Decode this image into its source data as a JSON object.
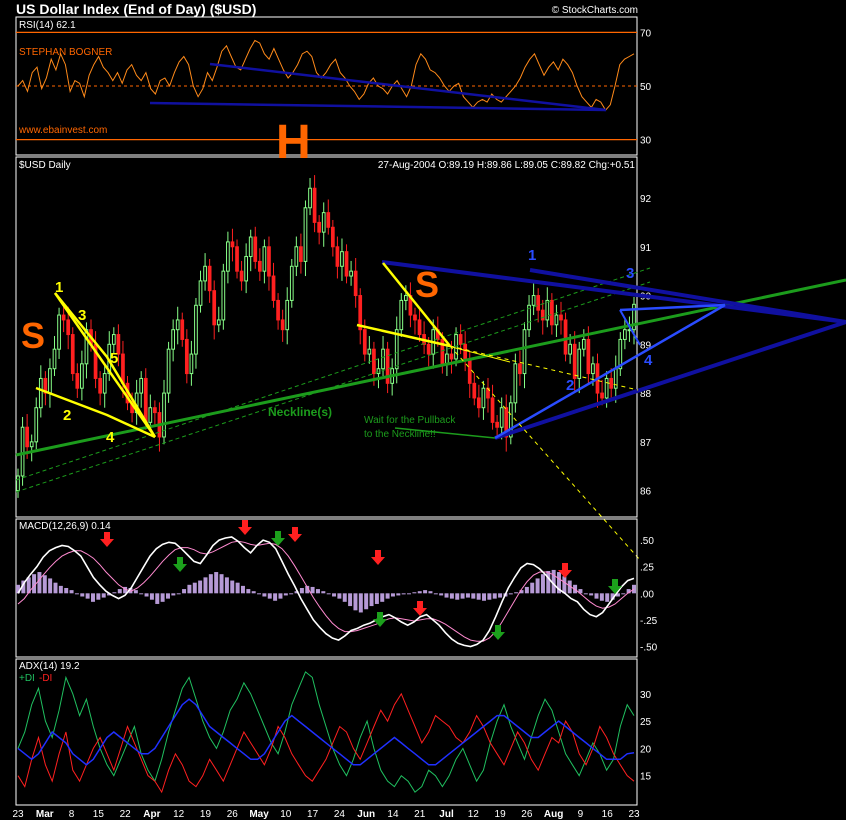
{
  "header": {
    "title": "US Dollar Index (End of Day) ($USD)",
    "copyright": "© StockCharts.com"
  },
  "colors": {
    "background": "#000000",
    "panel_border": "#ffffff",
    "orange_line": "#ff6600",
    "up_candle": "#88ff88",
    "down_candle": "#ff2020",
    "neckline_green": "#1c9c1c",
    "trend_blue": "#1010a0",
    "bright_blue": "#2a4cff",
    "yellow": "#ffff00",
    "hist": "#b69ad6",
    "macd_line": "#ffffff",
    "signal_line": "#ff8ad0",
    "plus_di": "#20c060",
    "minus_di": "#ff2020",
    "adx": "#2030ff"
  },
  "chart_data": [
    {
      "type": "line",
      "panel": "rsi",
      "label": "RSI(14) 62.1",
      "author": "STEPHAN BOGNER",
      "website": "www.ebainvest.com",
      "ylim": [
        25,
        75
      ],
      "ticks": [
        30,
        50,
        70
      ],
      "ref_lines": [
        30,
        50,
        70
      ],
      "series": [
        {
          "values": [
            50,
            52,
            48,
            55,
            57,
            49,
            53,
            60,
            56,
            62,
            58,
            48,
            52,
            51,
            46,
            54,
            58,
            61,
            57,
            55,
            52,
            55,
            51,
            56,
            58,
            54,
            52,
            55,
            49,
            47,
            52,
            53,
            50,
            55,
            59,
            61,
            58,
            50,
            46,
            49,
            55,
            52,
            57,
            63,
            65,
            61,
            57,
            56,
            60,
            64,
            67,
            66,
            62,
            60,
            64,
            60,
            56,
            53,
            55,
            58,
            62,
            63,
            61,
            55,
            53,
            55,
            58,
            60,
            55,
            53,
            50,
            48,
            45,
            47,
            51,
            53,
            50,
            49,
            47,
            50,
            52,
            49,
            46,
            50,
            58,
            62,
            60,
            56,
            55,
            53,
            50,
            48,
            50,
            51,
            46,
            44,
            42,
            44,
            45,
            44,
            47,
            45,
            44,
            46,
            48,
            50,
            53,
            57,
            60,
            62,
            58,
            54,
            57,
            59,
            56,
            60,
            58,
            55,
            50,
            46,
            44,
            42,
            45,
            44,
            41,
            43,
            50,
            58,
            60,
            61,
            62
          ]
        }
      ]
    },
    {
      "type": "candlestick",
      "panel": "price",
      "label": "$USD Daily",
      "quote": "27-Aug-2004 O:89.19 H:89.86 L:89.05 C:89.82 Chg:+0.51",
      "ylim": [
        85.5,
        92.8
      ],
      "ticks": [
        86,
        87,
        88,
        89,
        90,
        91,
        92
      ],
      "closes": [
        86.3,
        87.3,
        86.9,
        87.0,
        87.7,
        88.3,
        88.0,
        88.5,
        88.9,
        89.6,
        89.5,
        89.2,
        88.4,
        88.1,
        88.6,
        89.3,
        89.0,
        88.3,
        88.0,
        88.4,
        89.0,
        89.2,
        88.8,
        88.2,
        87.8,
        87.6,
        88.0,
        88.3,
        87.4,
        87.7,
        87.6,
        87.1,
        88.0,
        88.9,
        89.3,
        89.5,
        89.1,
        88.4,
        88.8,
        89.8,
        90.3,
        90.6,
        90.1,
        89.4,
        89.5,
        90.5,
        91.1,
        91.0,
        90.5,
        90.3,
        90.8,
        91.2,
        90.7,
        90.5,
        91.0,
        90.4,
        89.9,
        89.5,
        89.3,
        89.9,
        90.6,
        91.0,
        90.7,
        91.8,
        92.2,
        91.5,
        91.3,
        91.7,
        91.4,
        91.0,
        90.6,
        90.9,
        90.4,
        90.5,
        90.0,
        89.3,
        88.8,
        88.9,
        88.4,
        88.5,
        88.9,
        88.2,
        88.5,
        89.3,
        89.9,
        90.0,
        89.6,
        89.5,
        89.2,
        89.0,
        88.8,
        89.3,
        89.1,
        88.6,
        88.8,
        88.7,
        89.2,
        89.0,
        88.7,
        88.2,
        87.9,
        87.7,
        88.1,
        87.9,
        87.4,
        87.3,
        87.7,
        87.1,
        87.8,
        88.6,
        88.4,
        89.3,
        89.8,
        90.0,
        89.7,
        89.5,
        89.9,
        89.4,
        89.6,
        89.5,
        88.8,
        89.0,
        88.3,
        88.9,
        89.1,
        88.4,
        88.6,
        88.0,
        87.9,
        88.3,
        88.1,
        88.5,
        89.1,
        89.3,
        89.3,
        89.82
      ],
      "annotations": {
        "H": "H",
        "S_left": "S",
        "S_right": "S",
        "neckline": "Neckline(s)",
        "pullback": "Wait for the Pullback to the Neckline!!",
        "yellow_numbers": [
          "1",
          "2",
          "3",
          "4",
          "5"
        ],
        "blue_numbers": [
          "1",
          "2",
          "3",
          "4"
        ]
      }
    },
    {
      "type": "bar",
      "panel": "macd",
      "label": "MACD(12,26,9) 0.14",
      "ylim": [
        -0.58,
        0.68
      ],
      "ticks": [
        ".50",
        ".25",
        ".00",
        "-.25",
        "-.50"
      ],
      "tick_values": [
        0.5,
        0.25,
        0.0,
        -0.25,
        -0.5
      ],
      "histogram": [
        0.08,
        0.12,
        0.15,
        0.18,
        0.2,
        0.17,
        0.14,
        0.1,
        0.07,
        0.05,
        0.03,
        0.0,
        -0.03,
        -0.05,
        -0.08,
        -0.06,
        -0.04,
        -0.02,
        0.01,
        0.04,
        0.06,
        0.05,
        0.03,
        0.0,
        -0.03,
        -0.06,
        -0.1,
        -0.08,
        -0.05,
        -0.02,
        0.0,
        0.04,
        0.08,
        0.1,
        0.12,
        0.15,
        0.18,
        0.2,
        0.18,
        0.15,
        0.12,
        0.1,
        0.07,
        0.04,
        0.02,
        0.0,
        -0.03,
        -0.05,
        -0.07,
        -0.05,
        -0.02,
        0.0,
        0.02,
        0.05,
        0.07,
        0.06,
        0.04,
        0.02,
        0.0,
        -0.03,
        -0.05,
        -0.08,
        -0.12,
        -0.16,
        -0.18,
        -0.15,
        -0.12,
        -0.1,
        -0.08,
        -0.05,
        -0.03,
        -0.02,
        -0.01,
        0.0,
        0.01,
        0.02,
        0.03,
        0.02,
        0.0,
        -0.02,
        -0.04,
        -0.05,
        -0.06,
        -0.05,
        -0.04,
        -0.05,
        -0.06,
        -0.07,
        -0.06,
        -0.05,
        -0.04,
        -0.03,
        -0.01,
        0.01,
        0.03,
        0.06,
        0.1,
        0.14,
        0.18,
        0.21,
        0.22,
        0.2,
        0.16,
        0.12,
        0.08,
        0.04,
        0.0,
        -0.02,
        -0.05,
        -0.07,
        -0.08,
        -0.06,
        -0.03,
        0.0,
        0.04,
        0.08
      ],
      "series": [
        {
          "values": [
            0.0,
            0.1,
            0.18,
            0.25,
            0.34,
            0.4,
            0.43,
            0.45,
            0.44,
            0.4,
            0.35,
            0.25,
            0.15,
            0.08,
            0.02,
            -0.02,
            -0.05,
            -0.02,
            0.05,
            0.15,
            0.25,
            0.35,
            0.42,
            0.46,
            0.48,
            0.47,
            0.42,
            0.36,
            0.3,
            0.28,
            0.36,
            0.45,
            0.5,
            0.52,
            0.53,
            0.49,
            0.43,
            0.38,
            0.45,
            0.5,
            0.48,
            0.42,
            0.3,
            0.18,
            0.07,
            -0.05,
            -0.15,
            -0.25,
            -0.32,
            -0.38,
            -0.42,
            -0.44,
            -0.4,
            -0.35,
            -0.33,
            -0.3,
            -0.28,
            -0.25,
            -0.22,
            -0.2,
            -0.23,
            -0.27,
            -0.3,
            -0.27,
            -0.22,
            -0.2,
            -0.25,
            -0.3,
            -0.37,
            -0.43,
            -0.47,
            -0.49,
            -0.5,
            -0.48,
            -0.44,
            -0.35,
            -0.22,
            -0.08,
            0.05,
            0.15,
            0.24,
            0.28,
            0.27,
            0.23,
            0.17,
            0.1,
            0.04,
            0.0,
            -0.05,
            -0.08,
            -0.15,
            -0.2,
            -0.22,
            -0.18,
            -0.1,
            -0.02,
            0.06,
            0.12,
            0.14
          ]
        },
        {
          "values": [
            -0.1,
            -0.05,
            0.03,
            0.1,
            0.17,
            0.24,
            0.3,
            0.35,
            0.38,
            0.4,
            0.4,
            0.37,
            0.33,
            0.27,
            0.2,
            0.14,
            0.08,
            0.04,
            0.02,
            0.05,
            0.1,
            0.16,
            0.23,
            0.3,
            0.36,
            0.41,
            0.43,
            0.43,
            0.41,
            0.38,
            0.37,
            0.39,
            0.42,
            0.45,
            0.48,
            0.49,
            0.48,
            0.46,
            0.45,
            0.46,
            0.47,
            0.46,
            0.42,
            0.35,
            0.26,
            0.16,
            0.06,
            -0.04,
            -0.13,
            -0.21,
            -0.28,
            -0.33,
            -0.36,
            -0.36,
            -0.35,
            -0.33,
            -0.31,
            -0.29,
            -0.26,
            -0.24,
            -0.23,
            -0.24,
            -0.25,
            -0.26,
            -0.25,
            -0.24,
            -0.24,
            -0.26,
            -0.29,
            -0.33,
            -0.37,
            -0.41,
            -0.44,
            -0.45,
            -0.45,
            -0.42,
            -0.36,
            -0.27,
            -0.17,
            -0.07,
            0.03,
            0.11,
            0.17,
            0.2,
            0.2,
            0.18,
            0.14,
            0.1,
            0.06,
            0.02,
            -0.03,
            -0.08,
            -0.12,
            -0.14,
            -0.13,
            -0.1,
            -0.05,
            0.0,
            0.04
          ]
        }
      ],
      "red_arrows": 6,
      "green_arrows": 6
    },
    {
      "type": "line",
      "panel": "adx",
      "label": "ADX(14) 19.2",
      "legend": [
        "+DI",
        "-DI"
      ],
      "ylim": [
        10,
        36
      ],
      "ticks": [
        15,
        20,
        25,
        30
      ],
      "series": [
        {
          "name": "+DI",
          "values": [
            20,
            23,
            28,
            31,
            25,
            22,
            27,
            33,
            30,
            26,
            29,
            24,
            20,
            17,
            15,
            18,
            21,
            24,
            19,
            16,
            14,
            18,
            23,
            27,
            31,
            33,
            29,
            25,
            22,
            20,
            23,
            27,
            29,
            32,
            30,
            27,
            24,
            21,
            19,
            23,
            28,
            31,
            34,
            33,
            28,
            24,
            20,
            17,
            15,
            18,
            22,
            25,
            20,
            16,
            14,
            13,
            15,
            14,
            12,
            13,
            16,
            15,
            13,
            15,
            18,
            20,
            17,
            14,
            16,
            21,
            25,
            28,
            24,
            21,
            18,
            22,
            26,
            29,
            27,
            23,
            19,
            17,
            15,
            18,
            21,
            19,
            16,
            18,
            24,
            28,
            26
          ]
        },
        {
          "name": "-DI",
          "values": [
            15,
            13,
            18,
            22,
            17,
            14,
            19,
            23,
            16,
            14,
            17,
            20,
            22,
            19,
            16,
            20,
            24,
            21,
            18,
            15,
            14,
            12,
            16,
            19,
            17,
            14,
            13,
            15,
            18,
            16,
            14,
            17,
            20,
            23,
            21,
            19,
            17,
            20,
            24,
            22,
            19,
            17,
            15,
            14,
            16,
            18,
            21,
            24,
            23,
            20,
            18,
            21,
            24,
            27,
            25,
            28,
            30,
            27,
            24,
            21,
            23,
            26,
            25,
            24,
            22,
            21,
            23,
            26,
            24,
            21,
            19,
            17,
            20,
            23,
            21,
            18,
            16,
            19,
            22,
            21,
            25,
            23,
            19,
            17,
            20,
            24,
            22,
            19,
            17,
            15,
            14
          ]
        },
        {
          "name": "ADX",
          "values": [
            20,
            19,
            18,
            19,
            21,
            23,
            22,
            21,
            19,
            18,
            17,
            18,
            20,
            22,
            23,
            22,
            21,
            20,
            19,
            19,
            20,
            22,
            24,
            26,
            28,
            29,
            28,
            26,
            24,
            23,
            22,
            21,
            20,
            19,
            18,
            18,
            19,
            21,
            23,
            25,
            26,
            25,
            24,
            23,
            22,
            21,
            20,
            19,
            18,
            17,
            17,
            18,
            19,
            20,
            21,
            22,
            21,
            20,
            19,
            18,
            17,
            17,
            18,
            19,
            20,
            21,
            22,
            23,
            24,
            25,
            26,
            26,
            25,
            24,
            23,
            22,
            22,
            23,
            24,
            25,
            24,
            23,
            22,
            21,
            20,
            19,
            18,
            18,
            18,
            19,
            19.2
          ]
        }
      ]
    }
  ],
  "x_axis": {
    "dates": [
      "23",
      "Mar",
      "8",
      "15",
      "22",
      "Apr",
      "12",
      "19",
      "26",
      "May",
      "10",
      "17",
      "24",
      "Jun",
      "14",
      "21",
      "Jul",
      "12",
      "19",
      "26",
      "Aug",
      "9",
      "16",
      "23"
    ],
    "month_labels": [
      "Mar",
      "Apr",
      "May",
      "Jun",
      "Jul",
      "Aug"
    ]
  }
}
